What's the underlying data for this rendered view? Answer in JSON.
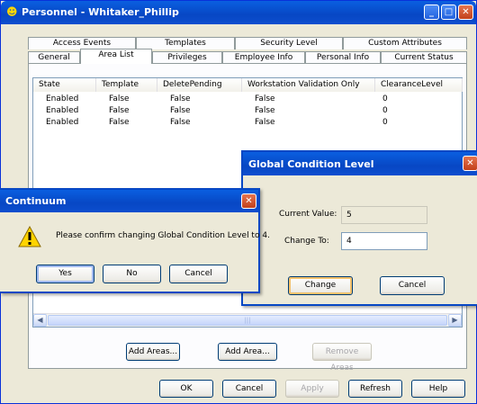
{
  "main_window": {
    "title": "Personnel - Whitaker_Phillip",
    "tabs_back": [
      "Access Events",
      "Templates",
      "Security Level",
      "Custom Attributes"
    ],
    "tabs_front": [
      "General",
      "Area List",
      "Privileges",
      "Employee Info",
      "Personal Info",
      "Current Status"
    ],
    "columns": [
      "State",
      "Template",
      "DeletePending",
      "Workstation Validation Only",
      "ClearanceLevel"
    ],
    "rows": [
      [
        "Enabled",
        "False",
        "False",
        "False",
        "0"
      ],
      [
        "Enabled",
        "False",
        "False",
        "False",
        "0"
      ],
      [
        "Enabled",
        "False",
        "False",
        "False",
        "0"
      ]
    ],
    "area_buttons": [
      "Add Areas...",
      "Add Area...",
      "Remove Areas"
    ],
    "bottom_buttons": [
      "OK",
      "Cancel",
      "Apply",
      "Refresh",
      "Help"
    ]
  },
  "gcl_dialog": {
    "title": "Global Condition Level",
    "current_label": "Current Value:",
    "current_value": "5",
    "change_label": "Change To:",
    "change_value": "4",
    "change_button": "Change",
    "cancel_button": "Cancel"
  },
  "confirm_dialog": {
    "title": "Continuum",
    "message": "Please confirm changing Global Condition Level to 4.",
    "buttons": [
      "Yes",
      "No",
      "Cancel"
    ]
  },
  "colors": {
    "title_blue": "#0747c4",
    "face": "#ece9d8",
    "close_red": "#c1401b"
  }
}
